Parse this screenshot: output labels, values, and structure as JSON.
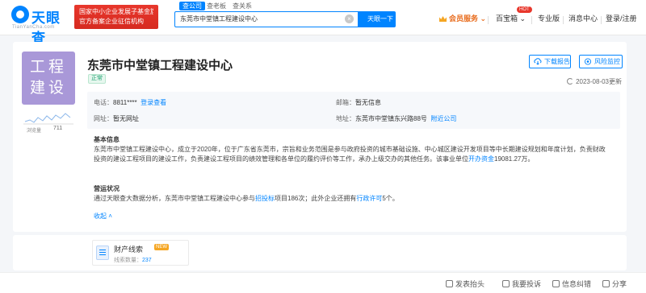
{
  "header": {
    "logo_text": "天眼查",
    "logo_sub": "TianYanCha.com",
    "gov_banner_line1": "国家中小企业发展子基金旗下",
    "gov_banner_line2": "官方备案企业征信机构",
    "search_tabs": [
      "查公司",
      "查老板",
      "查关系"
    ],
    "search_value": "东莞市中堂镇工程建设中心",
    "search_button": "天眼一下",
    "nav": {
      "vip": "会员服务",
      "hundred": "百宝箱",
      "hot": "HOT",
      "pro": "专业版",
      "messages": "消息中心",
      "login": "登录/注册"
    }
  },
  "company": {
    "avatar_line1": "工程",
    "avatar_line2": "建设",
    "views_label": "浏览量",
    "views_count": "711",
    "name": "东莞市中堂镇工程建设中心",
    "status": "正常",
    "download_label": "下载报告",
    "risk_label": "风险监控",
    "updated": "2023-08-03更新",
    "phone_label": "电话：",
    "phone_value": "8811****",
    "phone_link": "登录查看",
    "email_label": "邮箱：",
    "email_value": "暂无信息",
    "website_label": "网址：",
    "website_value": "暂无网址",
    "address_label": "地址：",
    "address_value": "东莞市中堂镇东兴路88号",
    "address_link": "附近公司",
    "basic_title": "基本信息",
    "basic_text_1": "东莞市中堂镇工程建设中心，成立于2020年，位于广东省东莞市，宗旨和业务范围是参与政府投资的城市基础设施、中心城区建设开发项目等中长期建设规划和年度计划，负责财政投资的建设工程项目的建设工作，负责建设工程项目的绩效管理和各单位的履约评价等工作，承办上级交办的其他任务。该事业单位",
    "basic_link": "开办资金",
    "basic_text_2": "19081.27万。",
    "ops_title": "营运状况",
    "ops_text_1": "通过天眼查大数据分析，东莞市中堂镇工程建设中心参与",
    "ops_link_1": "招投标",
    "ops_text_2": "项目186次；此外企业还拥有",
    "ops_link_2": "行政许可",
    "ops_text_3": "5个。",
    "collapse_label": "收起"
  },
  "tiles": {
    "title": "财产线索",
    "badge": "NEW",
    "sub_label": "线索数量：",
    "sub_count": "237"
  },
  "footer": {
    "post": "发表抬头",
    "feedback": "我要投诉",
    "report": "信息纠错",
    "share": "分享"
  },
  "colors": {
    "brand": "#0084ff",
    "avatar": "#a998d8",
    "status": "#1aa06d",
    "vip": "#e86a1a"
  }
}
